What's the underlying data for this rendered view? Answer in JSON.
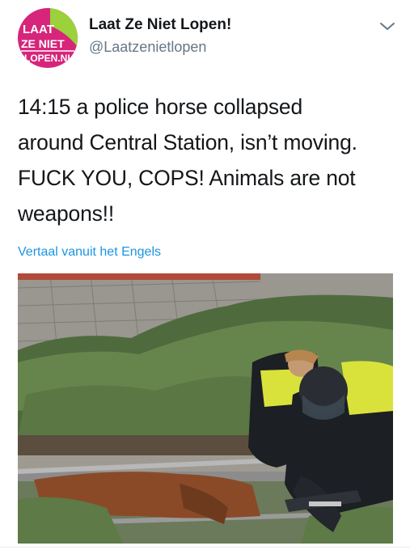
{
  "tweet": {
    "display_name": "Laat Ze Niet Lopen!",
    "handle": "@Laatzenietlopen",
    "avatar_text": [
      "LAAT",
      "ZE NIET",
      "LOPEN.NL"
    ],
    "text_lines": [
      "14:15 a police horse collapsed",
      "around Central Station, isn’t moving.",
      "FUCK YOU, COPS! Animals are not",
      "weapons!!"
    ],
    "translate_label": "Vertaal vanuit het Engels",
    "menu_icon": "chevron-down-icon"
  },
  "colors": {
    "link": "#1b95e0",
    "avatar_bg": "#d6257b",
    "avatar_accent": "#9bd13a"
  }
}
